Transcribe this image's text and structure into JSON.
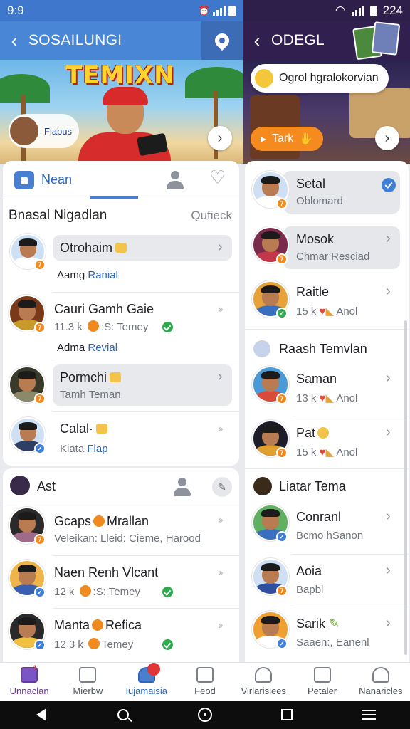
{
  "status_left": {
    "time": "9:9"
  },
  "status_right": {
    "time": "224"
  },
  "left_header": {
    "title": "SOSAILUNGI"
  },
  "right_header": {
    "title": "ODEGL"
  },
  "left_banner": {
    "title": "TEMIXN",
    "chip_label": "Fiabus"
  },
  "right_banner": {
    "pill_text": "Ogrol hgralokorvian",
    "button_label": "Tark"
  },
  "left_tabs": {
    "home_label": "Nean"
  },
  "left_section": {
    "title": "Bnasal Nigadlan",
    "right_label": "Qufieck",
    "rows": [
      {
        "name": "Otrohaim",
        "sub_prefix": "Aamg",
        "sub_link": "Ranial"
      },
      {
        "name": "Cauri Gamh Gaie",
        "sub": "11.3 k",
        "sub2": ":S: Temey",
        "extra_prefix": "Adma",
        "extra_link": "Revial"
      },
      {
        "name": "Pormchi",
        "sub": "Tamh Teman"
      },
      {
        "name": "Calal·",
        "sub_prefix": "Kiata",
        "sub_link": "Flap"
      }
    ]
  },
  "left_section2": {
    "title": "Ast",
    "rows": [
      {
        "name_a": "Gcaps",
        "name_b": "Mrallan",
        "sub": "Veleikan: Lleid: Cieme, Harood"
      },
      {
        "name": "Naen Renh Vlcant",
        "sub": "12 k",
        "sub2": ":S: Temey"
      },
      {
        "name_a": "Manta",
        "name_b": "Refica",
        "sub": "12 3 k",
        "sub2": "Temey"
      }
    ]
  },
  "right_list": {
    "rows_top": [
      {
        "name": "Setal",
        "sub": "Oblomard"
      },
      {
        "name": "Mosok",
        "sub": "Chmar Resciad"
      },
      {
        "name": "Raitle",
        "sub": "15 k",
        "sub2": "Anol"
      }
    ],
    "section1": "Raash Temvlan",
    "rows_mid": [
      {
        "name": "Saman",
        "sub": "13 k",
        "sub2": "Anol"
      },
      {
        "name": "Pat",
        "sub": "15 k",
        "sub2": "Anol"
      }
    ],
    "section2": "Liatar Tema",
    "rows_bottom": [
      {
        "name": "Conranl",
        "sub": "Bcmo hSanon"
      },
      {
        "name": "Aoia",
        "sub": "Bapbl"
      },
      {
        "name": "Sarik",
        "sub": "Saaen:, Eanenl"
      }
    ]
  },
  "bottom_nav": [
    {
      "label": "Unnaclan",
      "badge": "1"
    },
    {
      "label": "Mierbw"
    },
    {
      "label": "Iujamaisia"
    },
    {
      "label": "Feod"
    },
    {
      "label": "Virlarisiees"
    },
    {
      "label": "Petaler"
    },
    {
      "label": "Nanaricles"
    }
  ],
  "colors": {
    "left_accent": "#4a86d6",
    "right_accent": "#301f4f",
    "orange": "#f58a1f"
  }
}
